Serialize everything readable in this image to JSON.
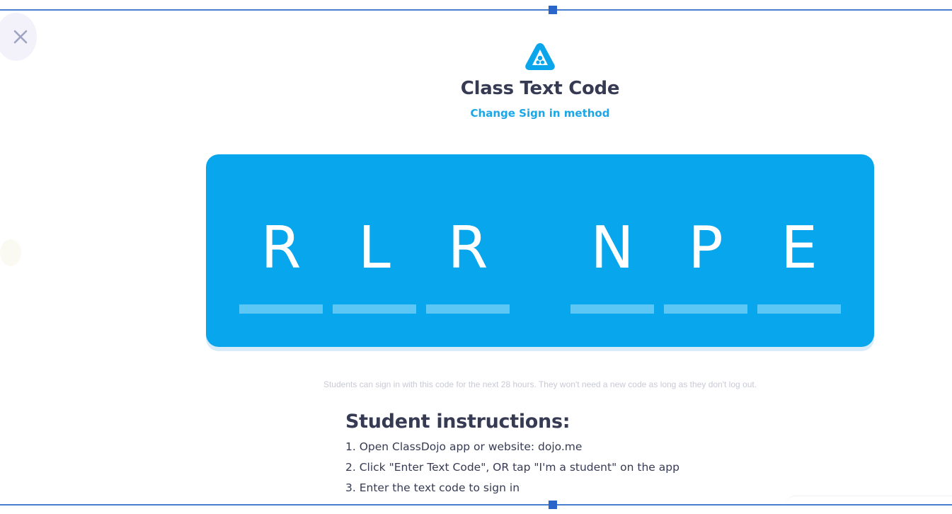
{
  "header": {
    "title": "Class Text Code",
    "change_method_link": "Change Sign in method"
  },
  "code": {
    "characters": [
      "R",
      "L",
      "R",
      "N",
      "P",
      "E"
    ]
  },
  "validity_note": "Students can sign in with this code for the next 28 hours. They won't need a new code as long as they don't log out.",
  "instructions": {
    "title": "Student instructions:",
    "steps": [
      "1. Open ClassDojo app or website: dojo.me",
      "2. Click \"Enter Text Code\", OR tap \"I'm a student\" on the app",
      "3. Enter the text code to sign in"
    ]
  },
  "icons": {
    "close": "close-icon",
    "logo": "abc-triangle-logo-icon"
  },
  "colors": {
    "accent": "#08a6ec",
    "link": "#1aa7e8",
    "text": "#363b53",
    "frame": "#2a66c9"
  }
}
